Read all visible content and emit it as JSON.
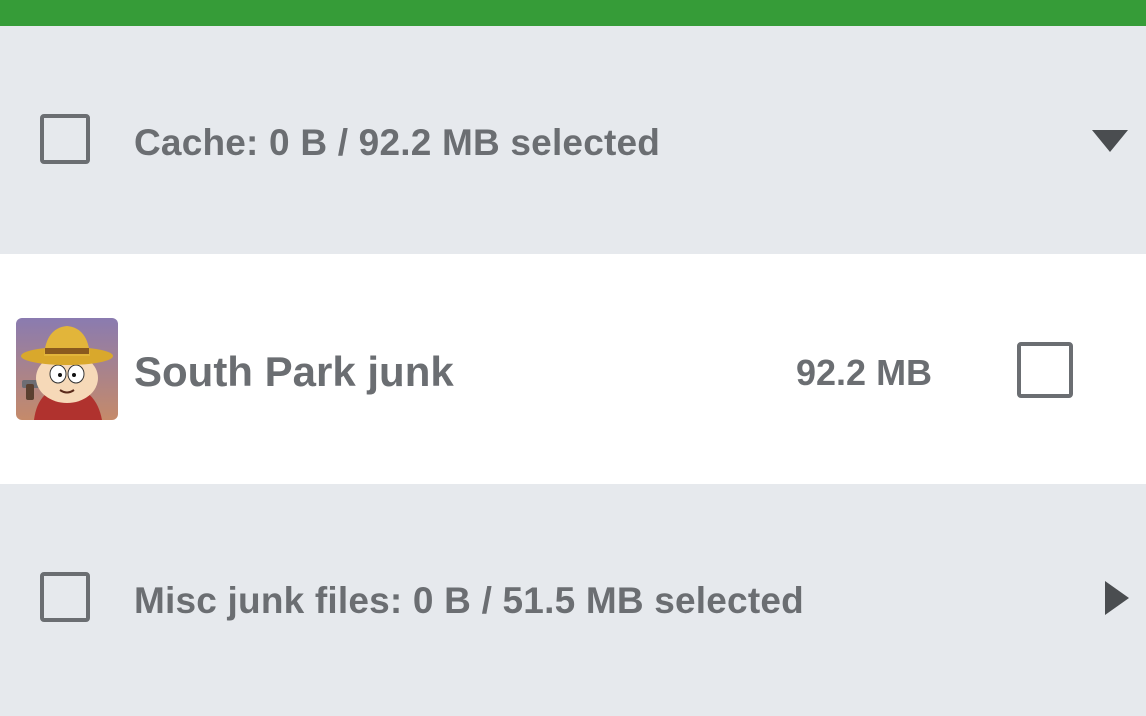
{
  "header": {
    "bar_color": "#369c38"
  },
  "groups": [
    {
      "label": "Cache: 0 B / 92.2 MB selected",
      "checked": false,
      "expanded": true,
      "expander_icon": "triangle-down-icon"
    },
    {
      "label": "Misc junk files: 0 B / 51.5 MB selected",
      "checked": false,
      "expanded": false,
      "expander_icon": "triangle-right-icon"
    }
  ],
  "items": [
    {
      "name": "South Park junk",
      "size": "92.2 MB",
      "checked": false,
      "icon": "south-park-app-icon"
    }
  ],
  "colors": {
    "group_background": "#e6e9ed",
    "item_background": "#ffffff",
    "text": "#6b6e72"
  }
}
